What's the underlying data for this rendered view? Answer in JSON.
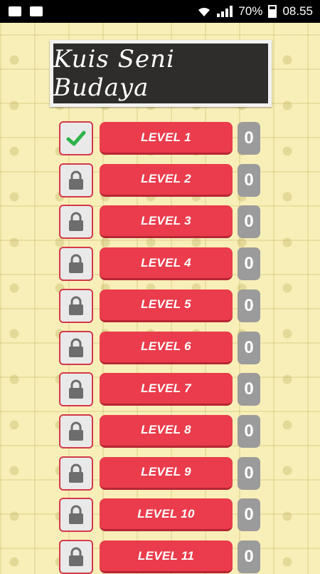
{
  "status_bar": {
    "left_icons": [
      "image-icon",
      "chat-icon"
    ],
    "right_icons": [
      "wifi-icon",
      "signal-icon",
      "battery-icon"
    ],
    "battery": "70%",
    "time": "08.55"
  },
  "title": "Kuis Seni Budaya",
  "colors": {
    "background": "#f8efb8",
    "level_button": "#ea3c4c",
    "status_border": "#d23a4a",
    "score_box": "#9b9b9b",
    "board": "#2e2d2c",
    "check": "#2db34a",
    "lock": "#6d6d6d"
  },
  "levels": [
    {
      "label": "LEVEL 1",
      "status_icon": "check-icon",
      "score": "0"
    },
    {
      "label": "LEVEL 2",
      "status_icon": "lock-icon",
      "score": "0"
    },
    {
      "label": "LEVEL 3",
      "status_icon": "lock-icon",
      "score": "0"
    },
    {
      "label": "LEVEL 4",
      "status_icon": "lock-icon",
      "score": "0"
    },
    {
      "label": "LEVEL 5",
      "status_icon": "lock-icon",
      "score": "0"
    },
    {
      "label": "LEVEL 6",
      "status_icon": "lock-icon",
      "score": "0"
    },
    {
      "label": "LEVEL 7",
      "status_icon": "lock-icon",
      "score": "0"
    },
    {
      "label": "LEVEL 8",
      "status_icon": "lock-icon",
      "score": "0"
    },
    {
      "label": "LEVEL 9",
      "status_icon": "lock-icon",
      "score": "0"
    },
    {
      "label": "LEVEL 10",
      "status_icon": "lock-icon",
      "score": "0"
    },
    {
      "label": "LEVEL 11",
      "status_icon": "lock-icon",
      "score": "0"
    }
  ]
}
